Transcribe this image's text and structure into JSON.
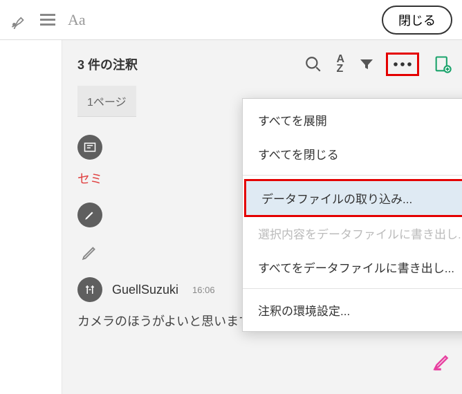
{
  "toolbar": {
    "font_label": "Aa",
    "close_label": "閉じる"
  },
  "panel": {
    "title": "3 件の注釈",
    "page_label": "1ページ"
  },
  "comments": {
    "first_text": "セミ",
    "user": "GuellSuzuki",
    "time": "16:06",
    "body": "カメラのほうがよいと思います"
  },
  "menu": {
    "expand_all": "すべてを展開",
    "collapse_all": "すべてを閉じる",
    "import_data": "データファイルの取り込み...",
    "export_selected": "選択内容をデータファイルに書き出し...",
    "export_all": "すべてをデータファイルに書き出し...",
    "preferences": "注釈の環境設定..."
  }
}
